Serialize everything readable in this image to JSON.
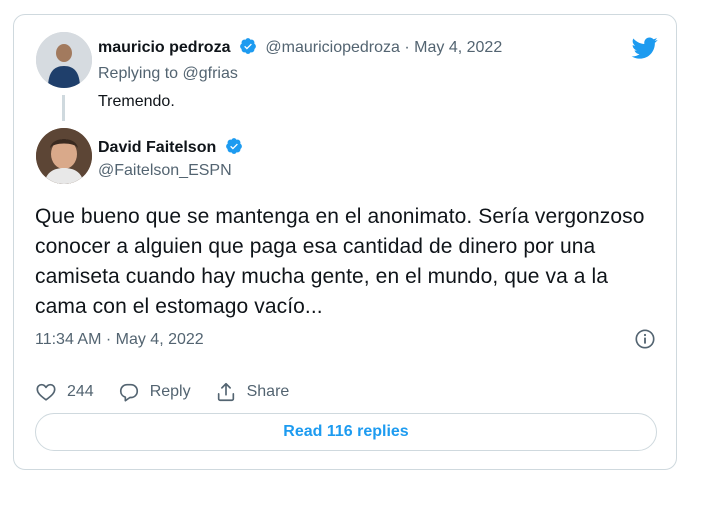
{
  "reply_tweet": {
    "display_name": "mauricio pedroza",
    "handle": "@mauriciopedroza",
    "separator": "·",
    "date": "May 4, 2022",
    "replying_prefix": "Replying to ",
    "replying_to": "@gfrias",
    "text": "Tremendo."
  },
  "quoted_tweet": {
    "display_name": "David Faitelson",
    "handle": "@Faitelson_ESPN",
    "text": "Que bueno que se mantenga en el anonimato. Sería vergonzoso conocer a alguien que paga esa cantidad de dinero por una camiseta cuando hay mucha gente, en el mundo, que va a la cama con el estomago vacío...",
    "timestamp": "11:34 AM · May 4, 2022"
  },
  "actions": {
    "like_count": "244",
    "reply_label": "Reply",
    "share_label": "Share"
  },
  "read_replies_label": "Read 116 replies",
  "colors": {
    "accent": "#1d9bf0",
    "muted": "#536471",
    "border": "#cfd9de"
  },
  "icons": [
    "twitter-bird-icon",
    "verified-badge-icon",
    "info-icon",
    "heart-icon",
    "reply-bubble-icon",
    "share-icon"
  ]
}
